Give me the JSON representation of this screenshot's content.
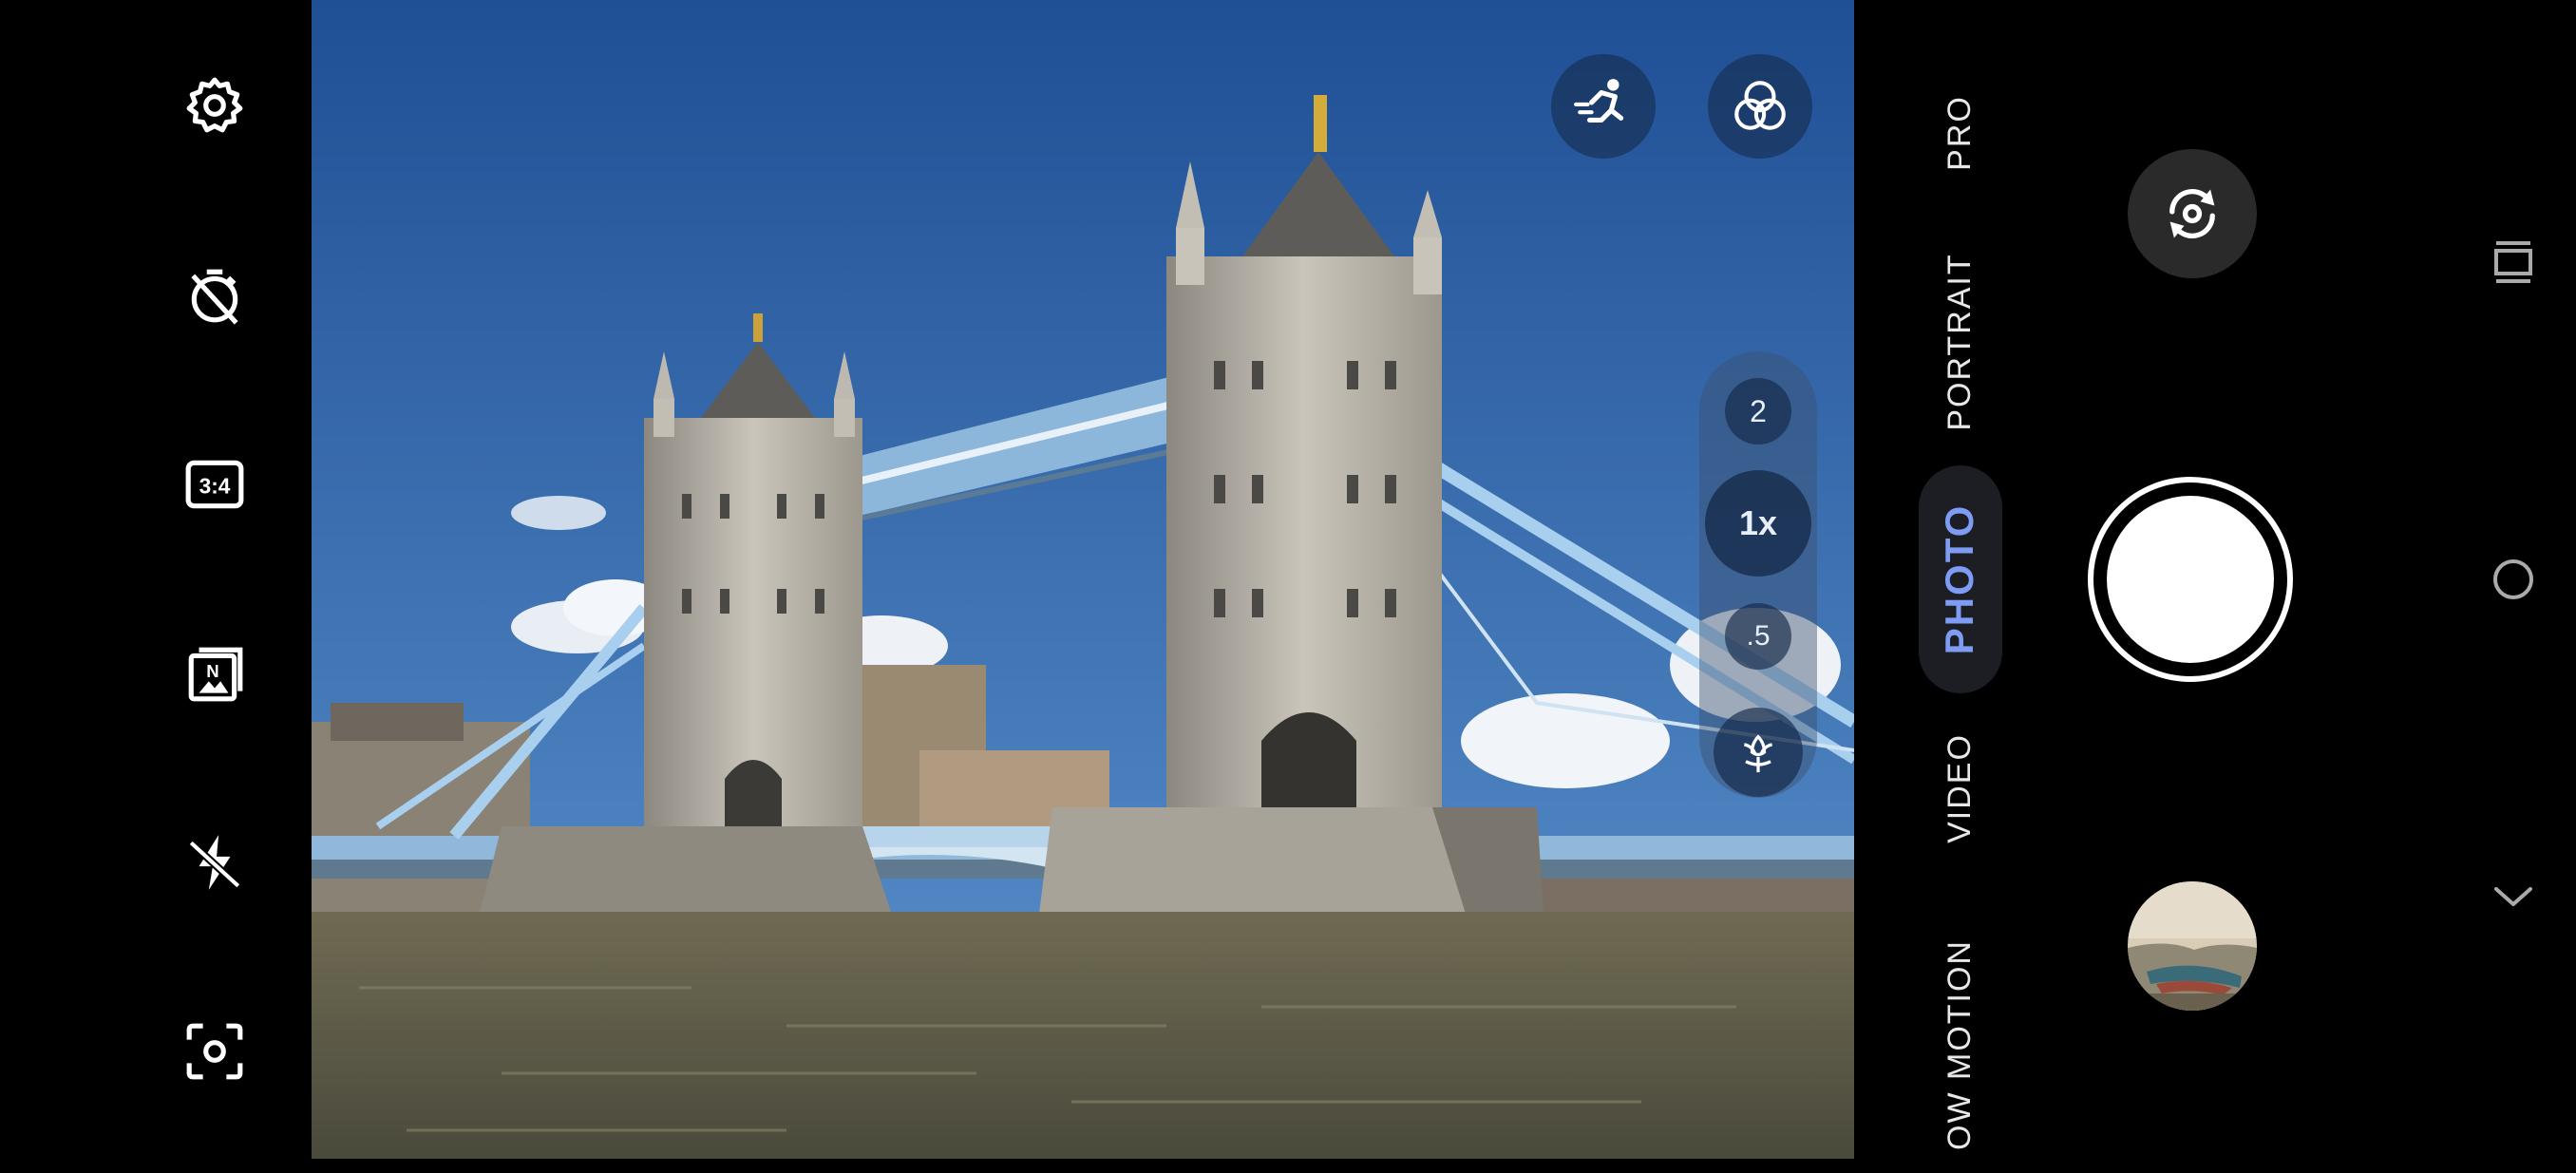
{
  "left_toolbar": {
    "items": [
      {
        "icon": "gear-icon"
      },
      {
        "icon": "timer-off-icon"
      },
      {
        "icon": "aspect-ratio-icon",
        "label": "3:4"
      },
      {
        "icon": "night-mode-icon",
        "label": "N"
      },
      {
        "icon": "flash-off-icon"
      },
      {
        "icon": "focus-scan-icon"
      }
    ]
  },
  "viewfinder": {
    "top_buttons": [
      {
        "icon": "motion-running-icon"
      },
      {
        "icon": "filters-icon"
      }
    ],
    "zoom": {
      "options": [
        "2",
        "1x",
        ".5"
      ],
      "selected": "1x",
      "macro_icon": "macro-flower-icon"
    }
  },
  "modes": {
    "items": [
      "PRO",
      "PORTRAIT",
      "PHOTO",
      "VIDEO",
      "SLOW MOTION"
    ],
    "visible_labels": {
      "pro": "PRO",
      "portrait": "PORTRAIT",
      "photo": "PHOTO",
      "video": "VIDEO",
      "slow_motion": "OW MOTION"
    },
    "selected": "PHOTO"
  },
  "controls": {
    "switch_camera_icon": "switch-camera-icon",
    "shutter": "shutter-button",
    "gallery": "gallery-thumbnail"
  },
  "nav_bar": {
    "icons": [
      "recents-icon",
      "home-icon",
      "back-chevron-icon"
    ]
  },
  "colors": {
    "accent": "#7f9cf5",
    "sky_top": "#1f4f95",
    "sky_bottom": "#5d95cf",
    "bridge_blue": "#9fc6e8"
  }
}
